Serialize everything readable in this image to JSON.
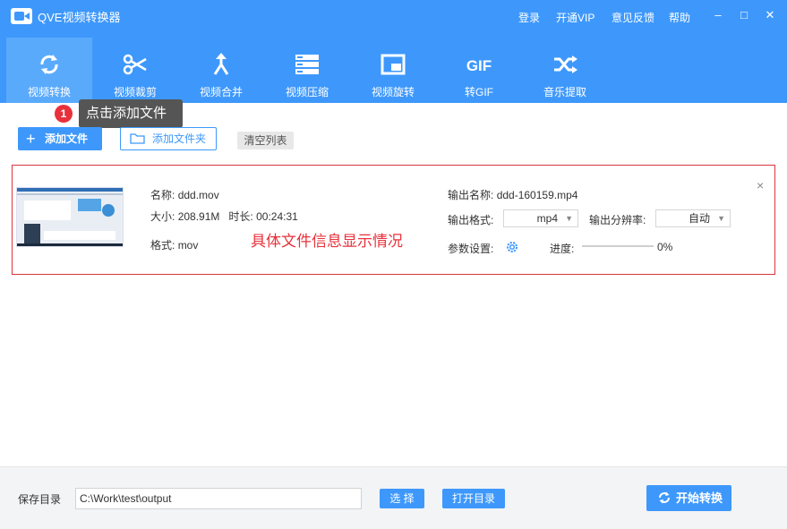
{
  "window": {
    "title": "QVE视频转换器",
    "links": [
      "登录",
      "开通VIP",
      "意见反馈",
      "帮助"
    ],
    "controls": {
      "minimize": "–",
      "maximize": "□",
      "close": "✕"
    }
  },
  "toolbar": {
    "items": [
      {
        "label": "视频转换",
        "icon": "refresh-icon",
        "active": true
      },
      {
        "label": "视频裁剪",
        "icon": "scissors-icon"
      },
      {
        "label": "视频合并",
        "icon": "merge-icon"
      },
      {
        "label": "视频压缩",
        "icon": "compress-icon"
      },
      {
        "label": "视频旋转",
        "icon": "rotate-icon"
      },
      {
        "label": "转GIF",
        "icon": "gif-icon",
        "icon_text": "GIF"
      },
      {
        "label": "音乐提取",
        "icon": "shuffle-icon"
      }
    ]
  },
  "tooltip": {
    "step": "1",
    "text": "点击添加文件"
  },
  "actions": {
    "add_file": "添加文件",
    "add_folder": "添加文件夹",
    "clear_list": "清空列表"
  },
  "file": {
    "name_label": "名称:",
    "name": "ddd.mov",
    "size_label": "大小:",
    "size": "208.91M",
    "duration_label": "时长:",
    "duration": "00:24:31",
    "format_label": "格式:",
    "format": "mov",
    "note": "具体文件信息显示情况",
    "output_name_label": "输出名称:",
    "output_name": "ddd-160159.mp4",
    "output_format_label": "输出格式:",
    "output_format": "mp4",
    "output_resolution_label": "输出分辨率:",
    "output_resolution": "自动",
    "params_label": "参数设置:",
    "progress_label": "进度:",
    "progress_text": "0%",
    "progress": 0
  },
  "footer": {
    "save_dir_label": "保存目录",
    "save_dir": "C:\\Work\\test\\output",
    "select_btn": "选 择",
    "open_dir_btn": "打开目录",
    "start_btn": "开始转换"
  },
  "colors": {
    "primary": "#3e98fb",
    "accent_red": "#e8313b",
    "tooltip_bg": "#555555"
  }
}
